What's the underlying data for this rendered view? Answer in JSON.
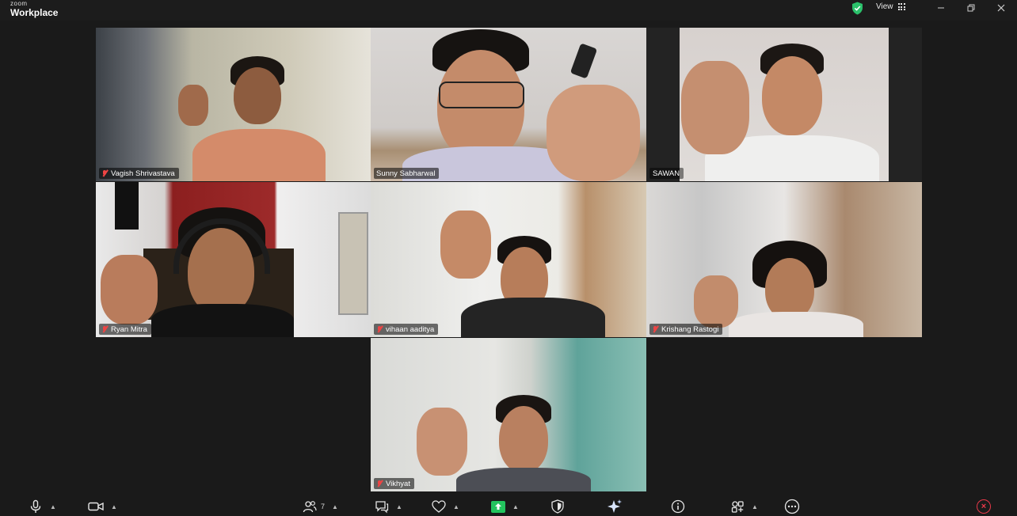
{
  "app": {
    "brand_small": "zoom",
    "brand_large": "Workplace"
  },
  "titlebar": {
    "view_label": "View"
  },
  "participants": [
    {
      "name": "Vagish Shrivastava",
      "muted": true
    },
    {
      "name": "Sunny Sabharwal",
      "muted": false,
      "active_speaker": true
    },
    {
      "name": "SAWAN",
      "muted": false
    },
    {
      "name": "Ryan Mitra",
      "muted": true
    },
    {
      "name": "vihaan aaditya",
      "muted": true
    },
    {
      "name": "Krishang Rastogi",
      "muted": true
    },
    {
      "name": "Vikhyat",
      "muted": true
    }
  ],
  "toolbar": {
    "participants_count": "7",
    "icons": [
      "microphone-icon",
      "video-camera-icon",
      "participants-icon",
      "chat-icon",
      "reactions-icon",
      "share-screen-icon",
      "security-icon",
      "ai-companion-icon",
      "info-icon",
      "apps-icon",
      "more-icon",
      "end-icon"
    ]
  },
  "colors": {
    "active_speaker": "#35d07f",
    "share": "#23c45e",
    "end": "#e8394a",
    "muted": "#ee4444",
    "security_shield": "#2bc16b"
  }
}
